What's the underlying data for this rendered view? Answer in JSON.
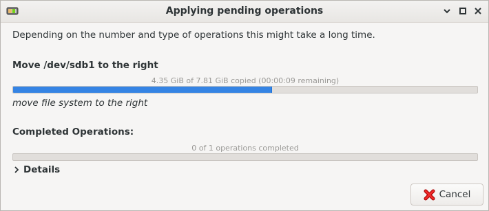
{
  "window": {
    "title": "Applying pending operations",
    "icons": {
      "app": "gparted-icon",
      "minimize": "minimize-icon",
      "maximize": "maximize-icon",
      "close": "close-icon"
    }
  },
  "description": "Depending on the number and type of operations this might take a long time.",
  "current_operation": {
    "title": "Move /dev/sdb1 to the right",
    "progress_text": "4.35 GiB of 7.81 GiB copied (00:00:09 remaining)",
    "progress_fraction": 0.557,
    "sub_operation": "move file system to the right"
  },
  "completed": {
    "title": "Completed Operations:",
    "progress_text": "0 of 1 operations completed",
    "progress_fraction": 0
  },
  "details": {
    "label": "Details",
    "icon": "chevron-right-icon"
  },
  "buttons": {
    "cancel_label": "Cancel",
    "cancel_icon": "red-x-icon"
  },
  "colors": {
    "accent": "#3584e4",
    "cancel_icon": "#cc0000"
  }
}
